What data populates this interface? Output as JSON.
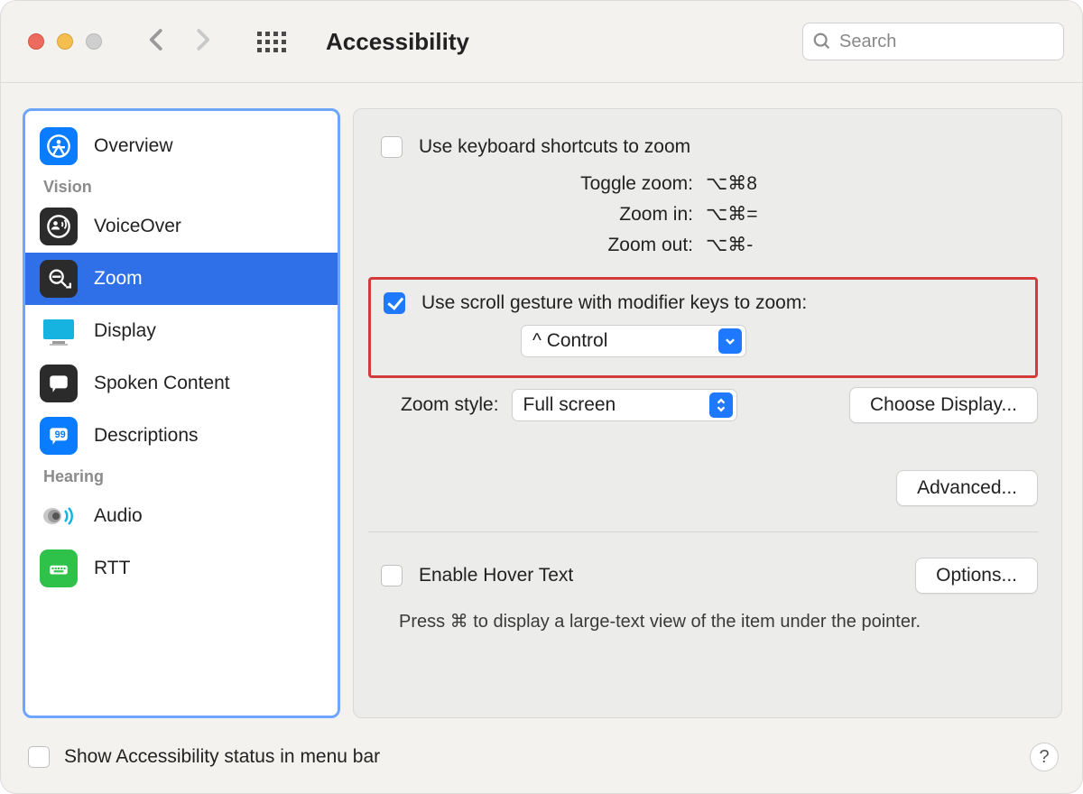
{
  "window": {
    "title": "Accessibility"
  },
  "search": {
    "placeholder": "Search"
  },
  "sidebar": {
    "overview": "Overview",
    "sections": {
      "vision": "Vision",
      "hearing": "Hearing"
    },
    "items": {
      "voiceover": "VoiceOver",
      "zoom": "Zoom",
      "display": "Display",
      "spoken": "Spoken Content",
      "descriptions": "Descriptions",
      "audio": "Audio",
      "rtt": "RTT"
    }
  },
  "main": {
    "kbd_shortcuts_label": "Use keyboard shortcuts to zoom",
    "shortcuts": {
      "toggle": {
        "label": "Toggle zoom:",
        "keys": "⌥⌘8"
      },
      "in": {
        "label": "Zoom in:",
        "keys": "⌥⌘="
      },
      "out": {
        "label": "Zoom out:",
        "keys": "⌥⌘-"
      }
    },
    "scroll_gesture_label": "Use scroll gesture with modifier keys to zoom:",
    "modifier_value": "^ Control",
    "zoom_style_label": "Zoom style:",
    "zoom_style_value": "Full screen",
    "choose_display": "Choose Display...",
    "advanced": "Advanced...",
    "hover_label": "Enable Hover Text",
    "options": "Options...",
    "hover_hint": "Press ⌘ to display a large-text view of the item under the pointer."
  },
  "footer": {
    "statusbar_label": "Show Accessibility status in menu bar"
  },
  "help": "?"
}
